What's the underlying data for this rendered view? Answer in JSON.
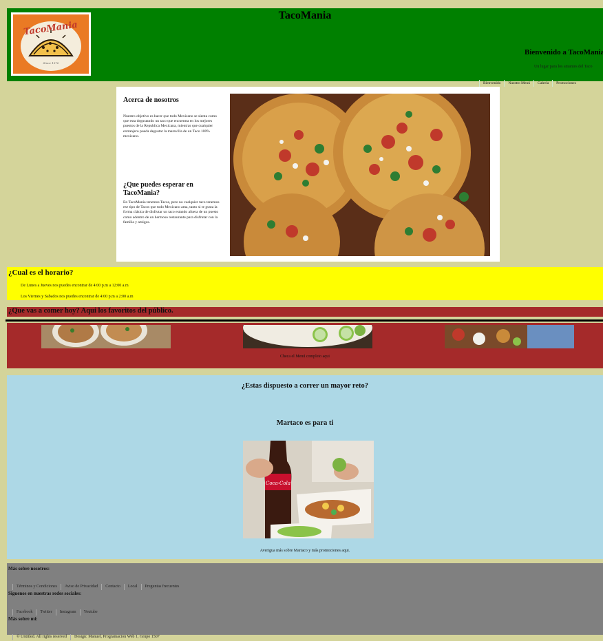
{
  "header": {
    "brand": "TacoMania",
    "logo_text": "TacoMania",
    "logo_tagline": "Since 1970",
    "welcome_title": "Bienvenido a TacoMania",
    "welcome_subtitle": "Un lugar para los amantes del Taco",
    "nav": [
      "Bienvenido",
      "Nuestro Menú",
      "Galería",
      "Promociones"
    ]
  },
  "about": {
    "title": "Acerca de nosotros",
    "paragraph": "Nuestro objetivo es hacer que todo Mexicano se sienta como que esta degustando un taco que encuentra en los mejores puestos de la Republica Mexicana, mientras que cualquier extranjero pueda degustar la maravilla de un Taco 100% mexicano.",
    "subtitle": "¿Que puedes esperar en TacoMania?",
    "paragraph2": "En TacoMania tenemos Tacos, pero no cualquier taco tenemos ese tipo de Tacos que todo Mexicano ama, tanto si te gusta la forma clásica de disfrutar un taco estando afuera de un puesto como adentro de un hermoso restaurante para disfrutar con la familia y amigos."
  },
  "schedule": {
    "title": "¿Cual es el horario?",
    "lines": [
      "De Lunes a Jueves nos puedes encontrar de 4:00 p.m a 12:00 a.m",
      "Los Viernes y Sabados nos puedes encontrar de 4:00 p.m a 2:00 a.m"
    ]
  },
  "favorites": {
    "title": "¿Que vas a comer hoy? Aqui los favoritos del público.",
    "menu_link": "Checa el Menú completo aqui"
  },
  "martaco": {
    "title": "¿Estas dispuesto a correr un mayor reto?",
    "subtitle": "Martaco es para ti",
    "brand_on_bottle": "Coca-Cola",
    "link": "Averigua más sobre Martaco y más promociones aqui."
  },
  "footer": {
    "about_title": "Más sobre nosotros:",
    "about_links": [
      "Términos y Condiciones",
      "Aviso de Privacidad",
      "Contacto",
      "Local",
      "Preguntas frecuentes"
    ],
    "social_title": "Siguenos en nuestras redes sociales:",
    "social_links": [
      "Facebook",
      "Twitter",
      "Instagram",
      "Youtube"
    ],
    "me_title": "Más sobre mi:",
    "credits": [
      "© Untitled. All rights reserved",
      "Design: Manuel, Programacion Web 1, Grupo 1507"
    ]
  },
  "colors": {
    "page_bg": "#d4d49a",
    "header_bg": "#008000",
    "schedule_bg": "#ffff00",
    "favorites_bg": "#a52a2a",
    "martaco_bg": "#add8e6",
    "footer_bg": "#808080",
    "logo_bg": "#ea7a24"
  }
}
